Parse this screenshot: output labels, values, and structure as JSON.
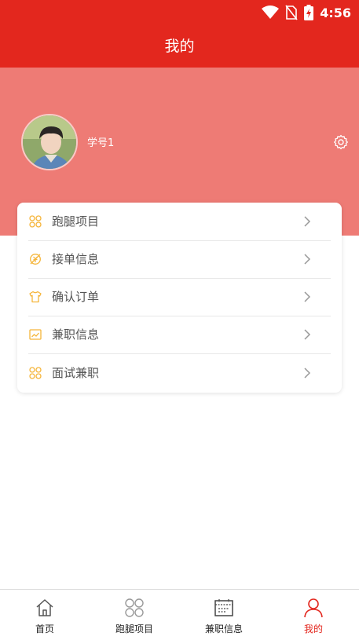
{
  "status_bar": {
    "time": "4:56"
  },
  "header": {
    "title": "我的"
  },
  "profile": {
    "student_id": "学号1"
  },
  "menu": {
    "items": [
      {
        "label": "跑腿项目",
        "icon": "grid-icon"
      },
      {
        "label": "接单信息",
        "icon": "no-cash-icon"
      },
      {
        "label": "确认订单",
        "icon": "shirt-icon"
      },
      {
        "label": "兼职信息",
        "icon": "chart-icon"
      },
      {
        "label": "面试兼职",
        "icon": "grid-icon"
      }
    ]
  },
  "tabbar": {
    "tabs": [
      {
        "label": "首页",
        "icon": "home-icon"
      },
      {
        "label": "跑腿项目",
        "icon": "grid-icon"
      },
      {
        "label": "兼职信息",
        "icon": "calendar-icon"
      },
      {
        "label": "我的",
        "icon": "user-icon",
        "active": true
      }
    ]
  },
  "colors": {
    "primary": "#e3271e",
    "profile_bg": "#ee7b75",
    "menu_icon": "#f5b53a"
  }
}
